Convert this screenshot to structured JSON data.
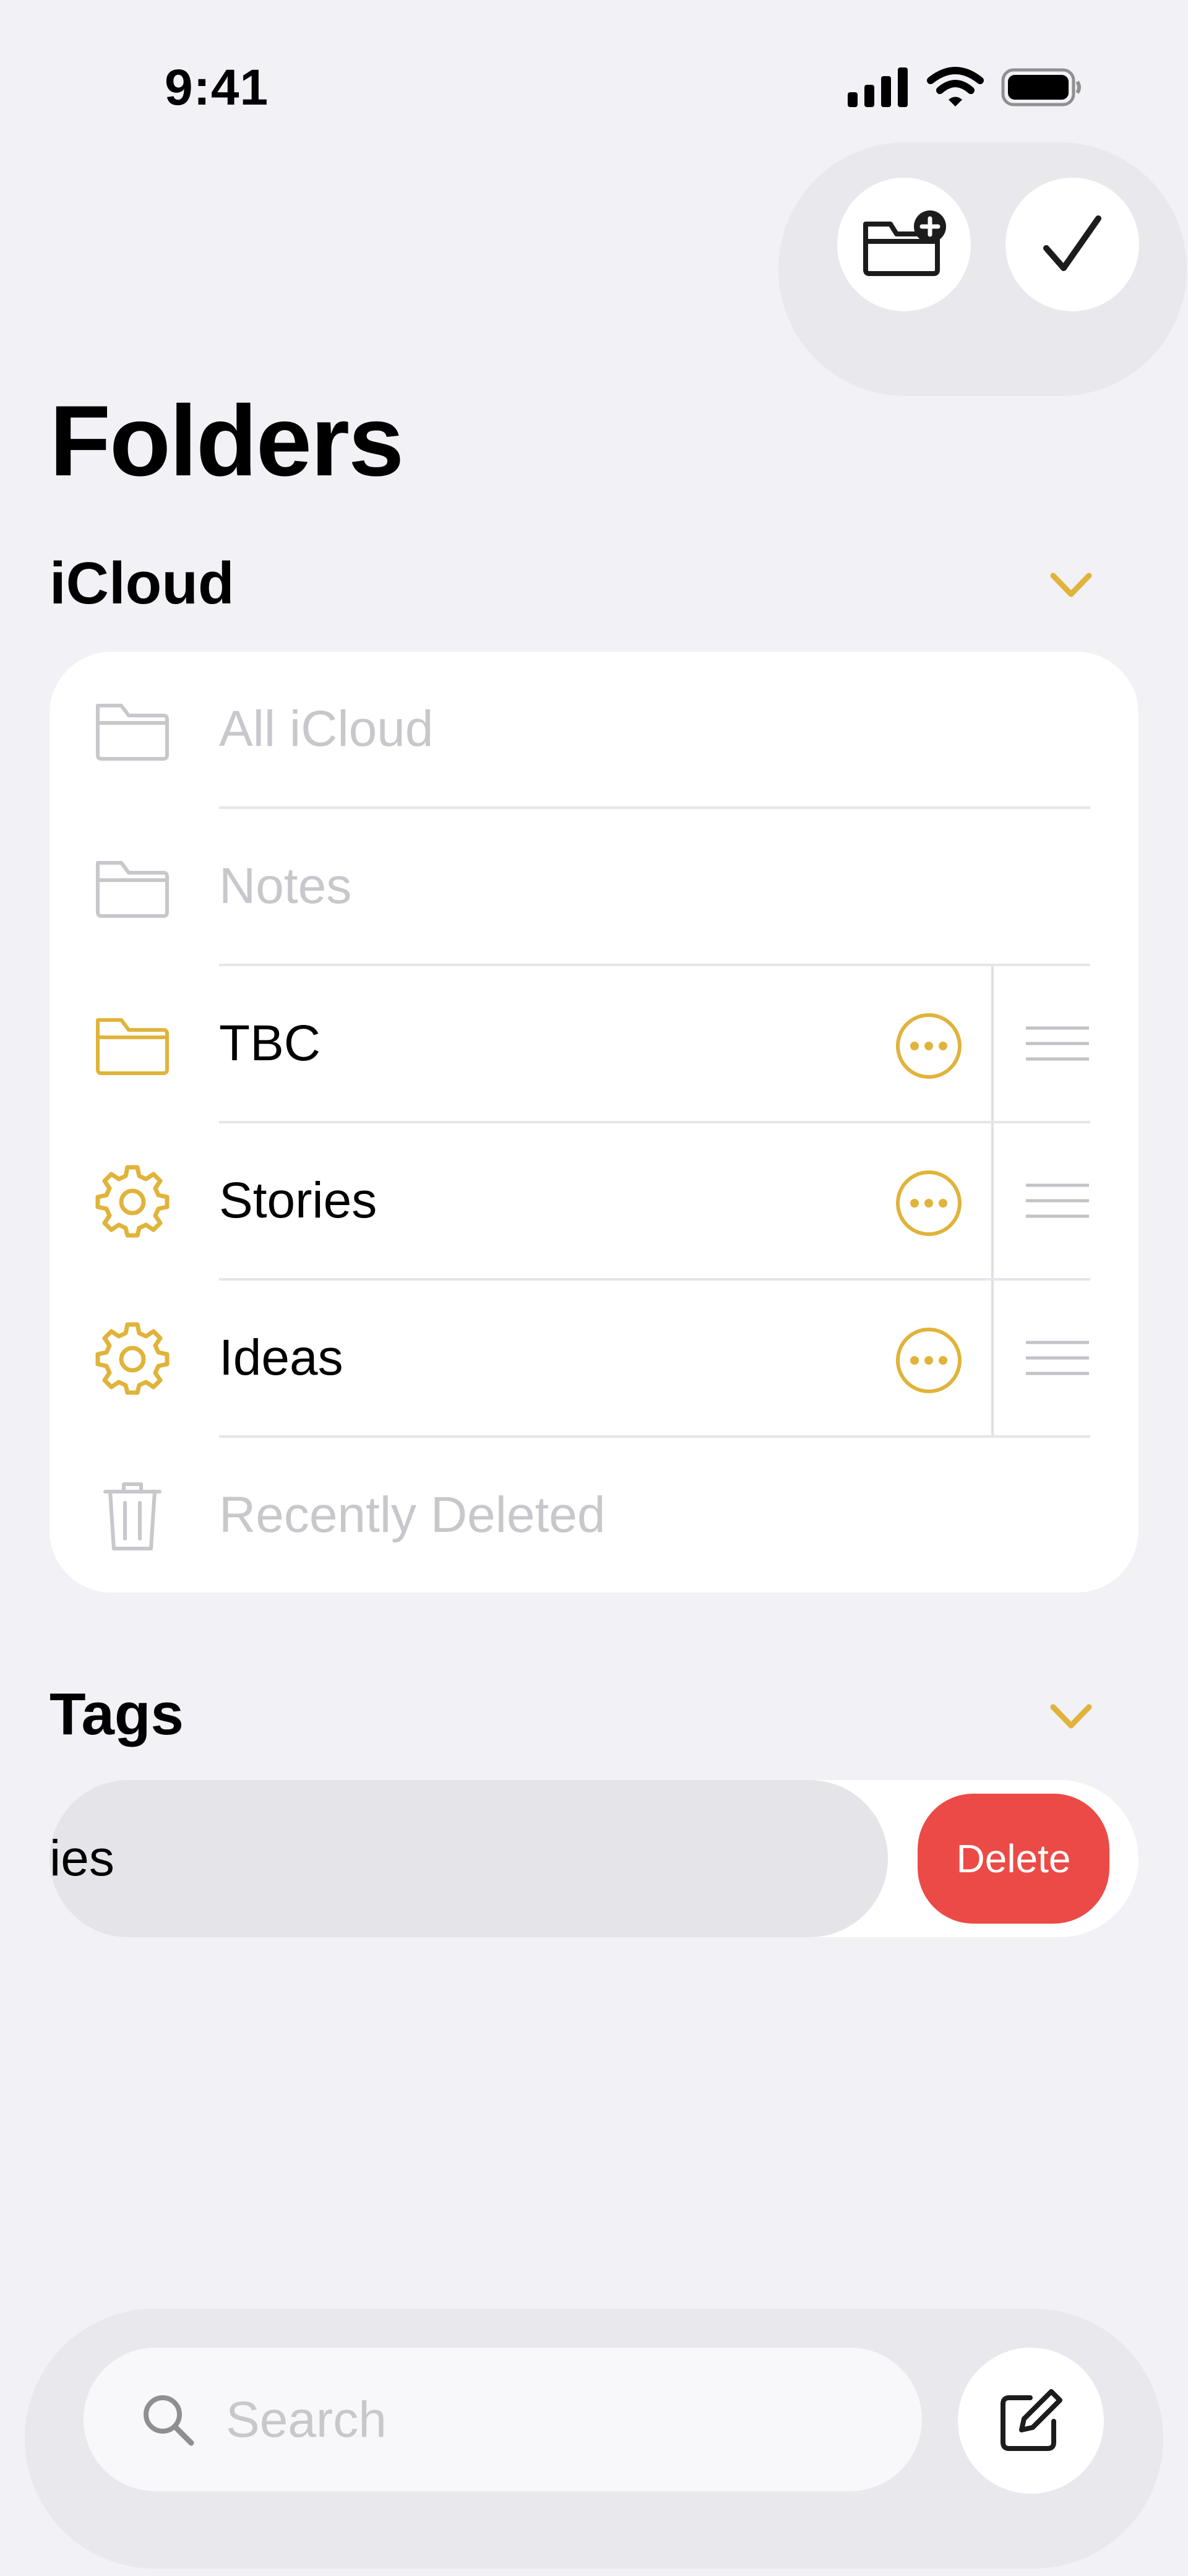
{
  "status_bar": {
    "time": "9:41"
  },
  "header": {
    "title": "Folders"
  },
  "sections": {
    "icloud": {
      "title": "iCloud",
      "folders": [
        {
          "label": "All iCloud",
          "icon": "folder-icon"
        },
        {
          "label": "Notes",
          "icon": "folder-icon"
        },
        {
          "label": "TBC",
          "icon": "folder-icon"
        },
        {
          "label": "Stories",
          "icon": "gear-icon"
        },
        {
          "label": "Ideas",
          "icon": "gear-icon"
        },
        {
          "label": "Recently Deleted",
          "icon": "trash-icon"
        }
      ]
    },
    "tags": {
      "title": "Tags",
      "row_label": "ies",
      "delete_label": "Delete"
    }
  },
  "bottom_bar": {
    "search_placeholder": "Search"
  },
  "colors": {
    "accent": "#e0b33a",
    "delete": "#ec4a46",
    "background": "#f1f1f6"
  }
}
